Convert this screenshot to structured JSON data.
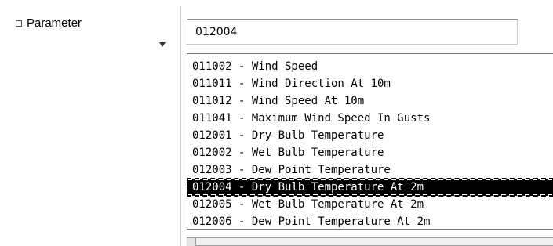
{
  "parameter": {
    "label": "Parameter",
    "input_value": "012004",
    "options": [
      "011002 - Wind Speed",
      "011011 - Wind Direction At 10m",
      "011012 - Wind Speed At 10m",
      "011041 - Maximum Wind Speed In Gusts",
      "012001 - Dry Bulb Temperature",
      "012002 - Wet Bulb Temperature",
      "012003 - Dew Point Temperature",
      "012004 - Dry Bulb Temperature At 2m",
      "012005 - Wet Bulb Temperature At 2m",
      "012006 - Dew Point Temperature At 2m"
    ],
    "selected_option": "012004 - Dry Bulb Temperature At 2m"
  },
  "icons": {
    "checkbox": "checkbox-icon",
    "dropdown": "triangle-down-icon"
  },
  "colors": {
    "selection_bg": "#000000",
    "selection_fg": "#ffffff"
  }
}
